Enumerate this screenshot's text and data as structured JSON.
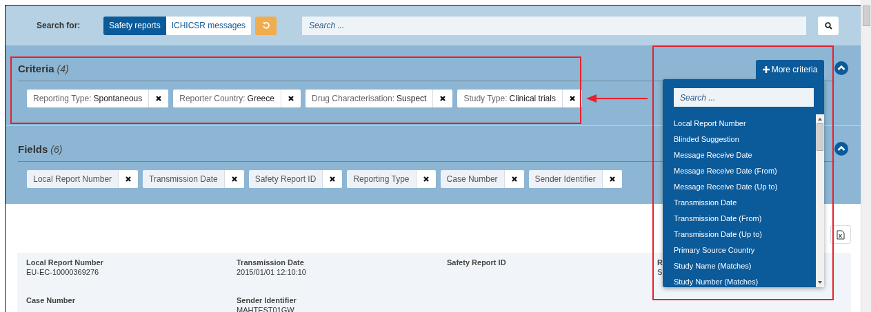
{
  "search_bar": {
    "label": "Search for:",
    "toggles": [
      {
        "label": "Safety reports",
        "selected": true
      },
      {
        "label": "ICHICSR messages",
        "selected": false
      }
    ],
    "search": {
      "placeholder": "Search ..."
    }
  },
  "criteria": {
    "title": "Criteria",
    "count": "(4)",
    "expanded": true,
    "items": [
      {
        "label": "Reporting Type:",
        "value": "Spontaneous"
      },
      {
        "label": "Reporter Country:",
        "value": "Greece"
      },
      {
        "label": "Drug Characterisation:",
        "value": "Suspect"
      },
      {
        "label": "Study Type:",
        "value": "Clinical trials"
      }
    ]
  },
  "more_criteria": {
    "button": "More criteria",
    "search": {
      "placeholder": "Search ..."
    },
    "items": [
      "Local Report Number",
      "Blinded Suggestion",
      "Message Receive Date",
      "Message Receive Date (From)",
      "Message Receive Date (Up to)",
      "Transmission Date",
      "Transmission Date (From)",
      "Transmission Date (Up to)",
      "Primary Source Country",
      "Study Name (Matches)",
      "Study Number (Matches)"
    ]
  },
  "fields": {
    "title": "Fields",
    "count": "(6)",
    "expanded": true,
    "items": [
      "Local Report Number",
      "Transmission Date",
      "Safety Report ID",
      "Reporting Type",
      "Case Number",
      "Sender Identifier"
    ]
  },
  "result": {
    "rows": [
      [
        {
          "label": "Local Report Number",
          "value": "EU-EC-10000369276"
        },
        {
          "label": "Transmission Date",
          "value": "2015/01/01 12:10:10"
        },
        {
          "label": "Safety Report ID"
        },
        {
          "label": "R",
          "value": "S"
        }
      ],
      [
        {
          "label": "Case Number"
        },
        {
          "label": "Sender Identifier",
          "value": "MAHTEST01GW"
        }
      ]
    ]
  }
}
